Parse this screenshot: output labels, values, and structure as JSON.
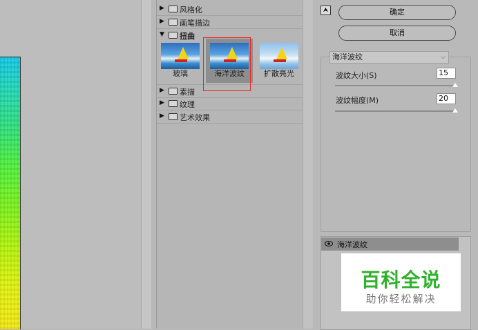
{
  "gallery": {
    "categories_top": [
      {
        "label": "风格化",
        "open": false
      },
      {
        "label": "画笔描边",
        "open": false
      },
      {
        "label": "扭曲",
        "open": true
      }
    ],
    "distort_thumbs": [
      {
        "label": "玻璃",
        "selected": false
      },
      {
        "label": "海洋波纹",
        "selected": true
      },
      {
        "label": "扩散亮光",
        "selected": false
      }
    ],
    "categories_bottom": [
      {
        "label": "素描",
        "open": false
      },
      {
        "label": "纹理",
        "open": false
      },
      {
        "label": "艺术效果",
        "open": false
      }
    ]
  },
  "buttons": {
    "ok_label": "确定",
    "cancel_label": "取消"
  },
  "settings": {
    "filter_selected": "海洋波纹",
    "ripple_size_label": "波纹大小(S)",
    "ripple_size_value": "15",
    "ripple_magnitude_label": "波纹幅度(M)",
    "ripple_magnitude_value": "20"
  },
  "layers": {
    "effect_layer_label": "海洋波纹"
  },
  "watermark": {
    "title": "百科全说",
    "subtitle": "助你轻松解决"
  }
}
